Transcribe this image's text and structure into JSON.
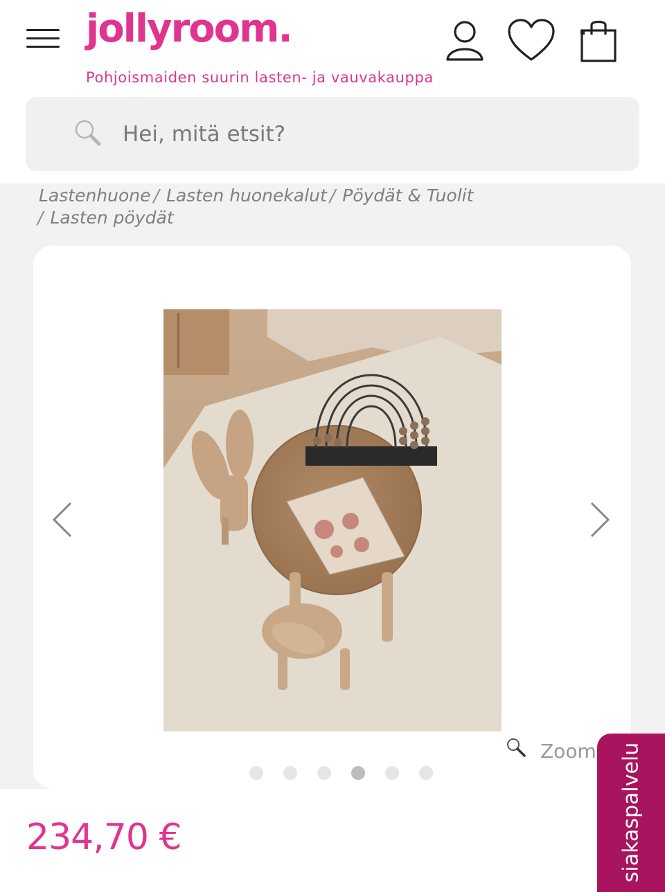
{
  "header": {
    "logo_text": "jollyroom.",
    "tagline": "Pohjoismaiden suurin lasten- ja vauvakauppa",
    "brand_color": "#e0348f",
    "icons": [
      "menu-icon",
      "account-icon",
      "heart-icon",
      "shopping-bag-icon"
    ]
  },
  "search": {
    "placeholder": "Hei, mitä etsit?",
    "icon": "search-icon"
  },
  "breadcrumb": {
    "items": [
      "Lastenhuone",
      "Lasten huonekalut",
      "Pöydät & Tuolit",
      "Lasten pöydät"
    ],
    "separator": "/"
  },
  "gallery": {
    "image_alt": "Round wooden kids table with bunny chairs",
    "dot_count": 6,
    "active_dot": 4,
    "zoom_label": "Zoom",
    "prev_icon": "chevron-left-icon",
    "next_icon": "chevron-right-icon"
  },
  "product": {
    "price": "234,70 €"
  },
  "customer_service": {
    "label": "siakaspalvelu",
    "color": "#a8155e"
  }
}
